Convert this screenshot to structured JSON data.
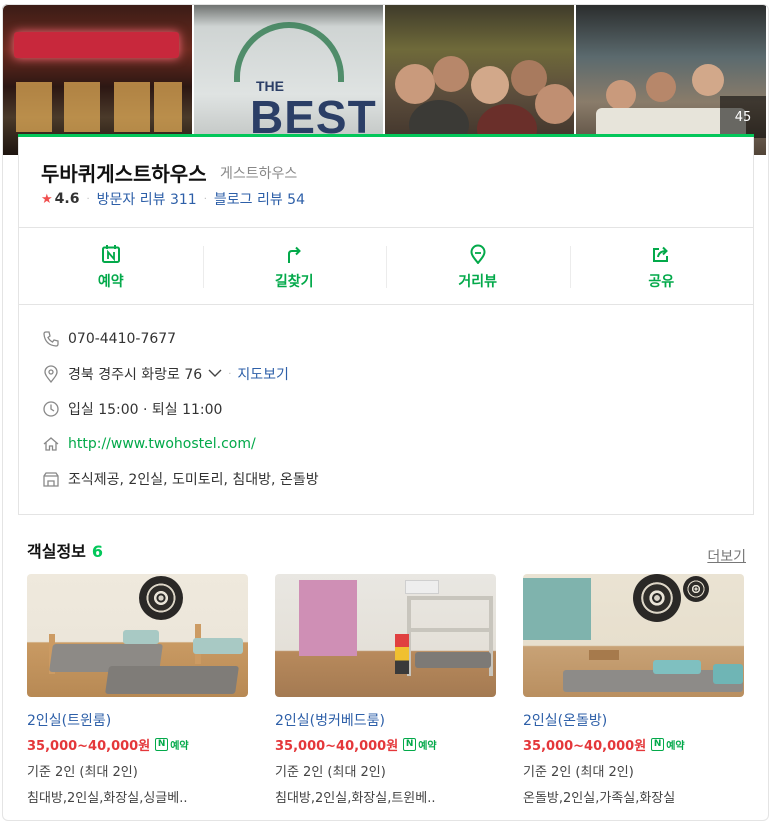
{
  "photos": {
    "count": "45"
  },
  "place": {
    "name": "두바퀴게스트하우스",
    "category": "게스트하우스",
    "rating": "4.6",
    "visitor_reviews": "방문자 리뷰 311",
    "blog_reviews": "블로그 리뷰 54"
  },
  "actions": [
    {
      "label": "예약",
      "icon": "naver-booking-icon"
    },
    {
      "label": "길찾기",
      "icon": "directions-icon"
    },
    {
      "label": "거리뷰",
      "icon": "street-view-icon"
    },
    {
      "label": "공유",
      "icon": "share-icon"
    }
  ],
  "info": {
    "phone": "070-4410-7677",
    "address": "경북 경주시 화랑로 76",
    "map_link": "지도보기",
    "hours": "입실 15:00 · 퇴실 11:00",
    "website": "http://www.twohostel.com/",
    "amenities": "조식제공, 2인실, 도미토리, 침대방, 온돌방"
  },
  "rooms": {
    "heading": "객실정보",
    "count": "6",
    "more": "더보기",
    "booking_badge": "예약",
    "items": [
      {
        "name": "2인실(트윈룸)",
        "price": "35,000~40,000원",
        "capacity": "기준 2인 (최대 2인)",
        "tags": "침대방,2인실,화장실,싱글베.."
      },
      {
        "name": "2인실(벙커베드룸)",
        "price": "35,000~40,000원",
        "capacity": "기준 2인 (최대 2인)",
        "tags": "침대방,2인실,화장실,트윈베.."
      },
      {
        "name": "2인실(온돌방)",
        "price": "35,000~40,000원",
        "capacity": "기준 2인 (최대 2인)",
        "tags": "온돌방,2인실,가족실,화장실"
      }
    ]
  },
  "colors": {
    "brand_green": "#03c75a",
    "price_red": "#e4373a",
    "link_blue": "#2d5fa8",
    "star": "#f04f4f"
  }
}
